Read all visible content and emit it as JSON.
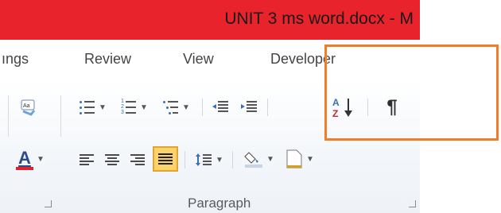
{
  "window": {
    "title": "UNIT 3 ms word.docx  -  M"
  },
  "tabs": [
    {
      "label": "ıngs"
    },
    {
      "label": "Review"
    },
    {
      "label": "View"
    },
    {
      "label": "Developer"
    }
  ],
  "ribbon": {
    "paragraph_group_label": "Paragraph",
    "buttons": {
      "bullets": "bullets-icon",
      "numbering": "numbering-icon",
      "multilevel": "multilevel-list-icon",
      "decrease_indent": "decrease-indent-icon",
      "increase_indent": "increase-indent-icon",
      "sort": "sort-az-icon",
      "show_hide": "¶",
      "align_left": "align-left-icon",
      "center": "align-center-icon",
      "align_right": "align-right-icon",
      "justify": "justify-icon",
      "line_spacing": "line-spacing-icon",
      "shading": "shading-icon",
      "borders": "borders-icon",
      "font_color": "A"
    },
    "colors": {
      "title_bar": "#e8232b",
      "font_color_underline": "#e0222c",
      "justify_active": "#fbd36a",
      "annotation_box": "#ef7e2b"
    }
  }
}
